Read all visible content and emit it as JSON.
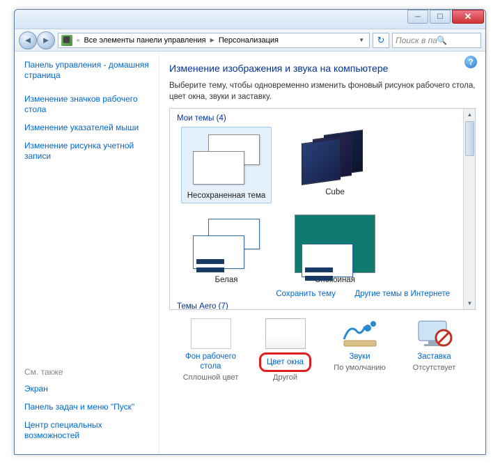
{
  "breadcrumb": {
    "root": "Все элементы панели управления",
    "current": "Персонализация"
  },
  "search": {
    "placeholder": "Поиск в панели ..."
  },
  "sidebar": {
    "home": "Панель управления - домашняя страница",
    "links": [
      "Изменение значков рабочего стола",
      "Изменение указателей мыши",
      "Изменение рисунка учетной записи"
    ],
    "also_label": "См. также",
    "also": [
      "Экран",
      "Панель задач и меню \"Пуск\"",
      "Центр специальных возможностей"
    ]
  },
  "main": {
    "title": "Изменение изображения и звука на компьютере",
    "desc": "Выберите тему, чтобы одновременно изменить фоновый рисунок рабочего стола, цвет окна, звуки и заставку.",
    "my_themes_label": "Мои темы (4)",
    "aero_label": "Темы Aero (7)",
    "themes": [
      {
        "name": "Несохраненная тема"
      },
      {
        "name": "Cube"
      },
      {
        "name": "Белая"
      },
      {
        "name": "Спокойная"
      }
    ],
    "save_theme": "Сохранить тему",
    "more_themes": "Другие темы в Интернете"
  },
  "bottom": {
    "bg": {
      "label": "Фон рабочего стола",
      "sub": "Сплошной цвет"
    },
    "color": {
      "label": "Цвет окна",
      "sub": "Другой"
    },
    "sound": {
      "label": "Звуки",
      "sub": "По умолчанию"
    },
    "saver": {
      "label": "Заставка",
      "sub": "Отсутствует"
    }
  }
}
